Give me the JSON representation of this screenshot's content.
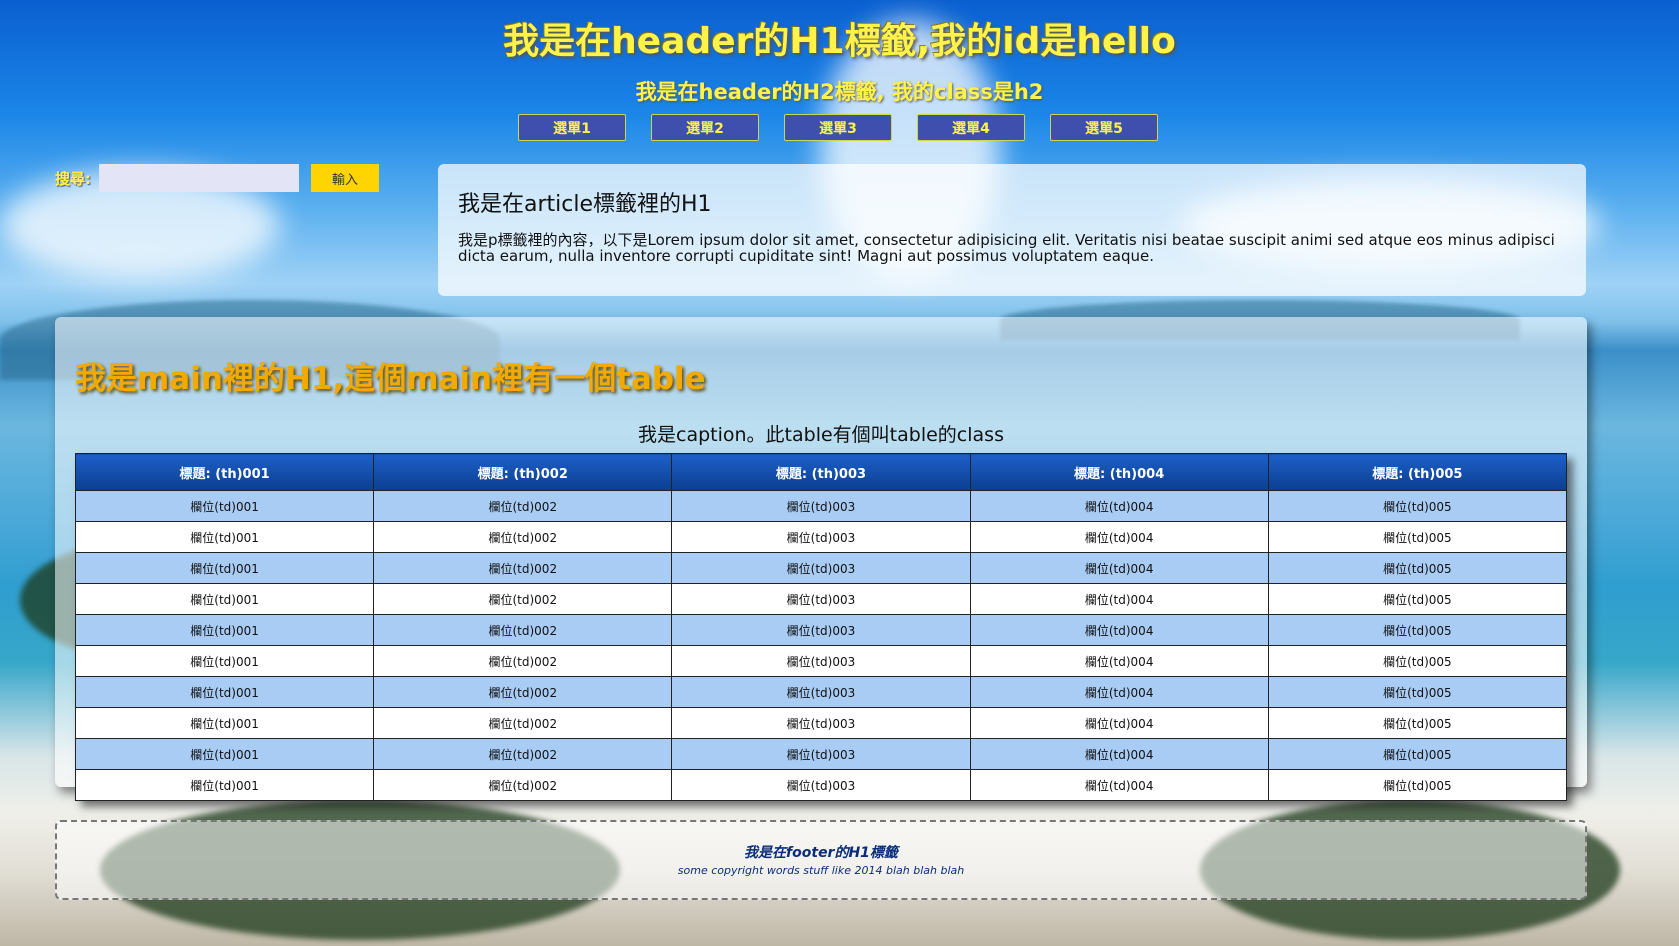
{
  "header": {
    "h1": "我是在header的H1標籤,我的id是hello",
    "h2": "我是在header的H2標籤, 我的class是h2"
  },
  "nav": {
    "items": [
      "選單1",
      "選單2",
      "選單3",
      "選單4",
      "選單5"
    ]
  },
  "search": {
    "label": "搜尋:",
    "value": "",
    "button": "輸入"
  },
  "article": {
    "h1": "我是在article標籤裡的H1",
    "p": "我是p標籤裡的內容，以下是Lorem ipsum dolor sit amet, consectetur adipisicing elit. Veritatis nisi beatae suscipit animi sed atque eos minus adipisci dicta earum, nulla inventore corrupti cupiditate sint! Magni aut possimus voluptatem eaque."
  },
  "main": {
    "h1": "我是main裡的H1,這個main裡有一個table",
    "table": {
      "caption": "我是caption。此table有個叫table的class",
      "headers": [
        "標題: (th)001",
        "標題: (th)002",
        "標題: (th)003",
        "標題: (th)004",
        "標題: (th)005"
      ],
      "rows": [
        [
          "欄位(td)001",
          "欄位(td)002",
          "欄位(td)003",
          "欄位(td)004",
          "欄位(td)005"
        ],
        [
          "欄位(td)001",
          "欄位(td)002",
          "欄位(td)003",
          "欄位(td)004",
          "欄位(td)005"
        ],
        [
          "欄位(td)001",
          "欄位(td)002",
          "欄位(td)003",
          "欄位(td)004",
          "欄位(td)005"
        ],
        [
          "欄位(td)001",
          "欄位(td)002",
          "欄位(td)003",
          "欄位(td)004",
          "欄位(td)005"
        ],
        [
          "欄位(td)001",
          "欄位(td)002",
          "欄位(td)003",
          "欄位(td)004",
          "欄位(td)005"
        ],
        [
          "欄位(td)001",
          "欄位(td)002",
          "欄位(td)003",
          "欄位(td)004",
          "欄位(td)005"
        ],
        [
          "欄位(td)001",
          "欄位(td)002",
          "欄位(td)003",
          "欄位(td)004",
          "欄位(td)005"
        ],
        [
          "欄位(td)001",
          "欄位(td)002",
          "欄位(td)003",
          "欄位(td)004",
          "欄位(td)005"
        ],
        [
          "欄位(td)001",
          "欄位(td)002",
          "欄位(td)003",
          "欄位(td)004",
          "欄位(td)005"
        ],
        [
          "欄位(td)001",
          "欄位(td)002",
          "欄位(td)003",
          "欄位(td)004",
          "欄位(td)005"
        ]
      ]
    }
  },
  "footer": {
    "h1": "我是在footer的H1標籤",
    "p": "some copyright words stuff like 2014 blah blah blah"
  },
  "colors": {
    "heading_yellow": "#fff34a",
    "main_heading_orange": "#f2a900",
    "nav_button": "#3f4fae",
    "search_button": "#ffd400",
    "table_header": "#0a3f8f",
    "table_row_alt": "#a9ccf5",
    "footer_text": "#0a2d7a"
  }
}
